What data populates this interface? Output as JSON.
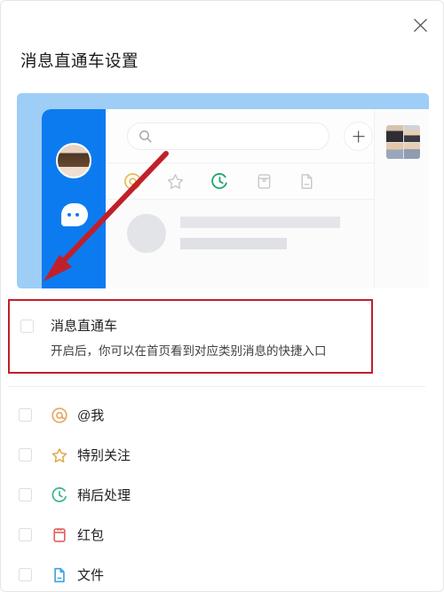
{
  "dialog": {
    "title": "消息直通车设置",
    "close_icon": "close-icon"
  },
  "preview": {
    "name": "message-express-preview",
    "sidebar": {
      "avatar_icon": "user-avatar-icon",
      "chat_icon": "chat-bubble-icon"
    },
    "search": {
      "icon": "search-icon",
      "placeholder": ""
    },
    "add_button": {
      "icon": "plus-icon"
    },
    "category_icons": [
      {
        "name": "at-icon",
        "color": "#e8b84b"
      },
      {
        "name": "star-icon",
        "color": "#c8c9cc"
      },
      {
        "name": "clock-later-icon",
        "color": "#1aa86a"
      },
      {
        "name": "red-packet-icon",
        "color": "#c8c9cc"
      },
      {
        "name": "file-icon",
        "color": "#c8c9cc"
      }
    ],
    "more_icon": "more-dots-icon",
    "group_avatar_icon": "group-avatar-icon",
    "annotation": {
      "name": "red-arrow-annotation",
      "color": "#c0202a"
    }
  },
  "main_option": {
    "checkbox_name": "message-express-checkbox",
    "checked": false,
    "title": "消息直通车",
    "description": "开启后，你可以在首页看到对应类别消息的快捷入口",
    "highlight_color": "#c0202a"
  },
  "options": [
    {
      "label": "@我",
      "icon": "at-icon",
      "color": "#e3a860",
      "checked": false
    },
    {
      "label": "特别关注",
      "icon": "star-icon",
      "color": "#e0a94f",
      "checked": false
    },
    {
      "label": "稍后处理",
      "icon": "clock-later-icon",
      "color": "#3bb58b",
      "checked": false
    },
    {
      "label": "红包",
      "icon": "red-packet-icon",
      "color": "#e0605c",
      "checked": false
    },
    {
      "label": "文件",
      "icon": "file-icon",
      "color": "#3ba2e0",
      "checked": false
    }
  ]
}
